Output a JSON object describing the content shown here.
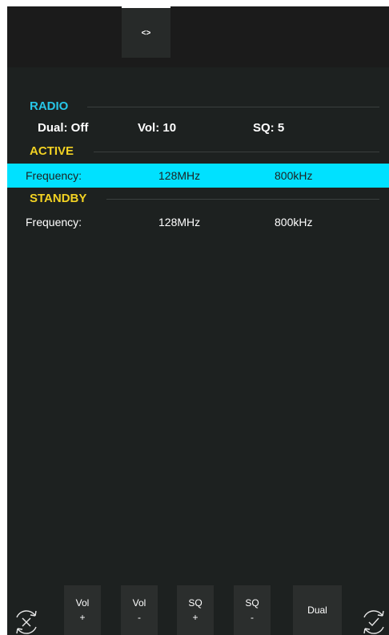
{
  "topbar": {
    "tab_label": "<>"
  },
  "radio": {
    "title": "RADIO",
    "dual": "Dual: Off",
    "vol": "Vol: 10",
    "sq": "SQ: 5"
  },
  "active": {
    "title": "ACTIVE",
    "label": "Frequency:",
    "mhz": "128MHz",
    "khz": "800kHz"
  },
  "standby": {
    "title": "STANDBY",
    "label": "Frequency:",
    "mhz": "128MHz",
    "khz": "800kHz"
  },
  "buttons": {
    "vol_up": {
      "top": "Vol",
      "bottom": "+"
    },
    "vol_down": {
      "top": "Vol",
      "bottom": "-"
    },
    "sq_up": {
      "top": "SQ",
      "bottom": "+"
    },
    "sq_down": {
      "top": "SQ",
      "bottom": "-"
    },
    "dual": "Dual"
  },
  "colors": {
    "background": "#1d2120",
    "radio_accent": "#27c6e8",
    "section_accent": "#f2d223",
    "active_highlight": "#00e1ff"
  },
  "icons": {
    "left": "cancel-sync-icon",
    "right": "confirm-sync-icon"
  }
}
